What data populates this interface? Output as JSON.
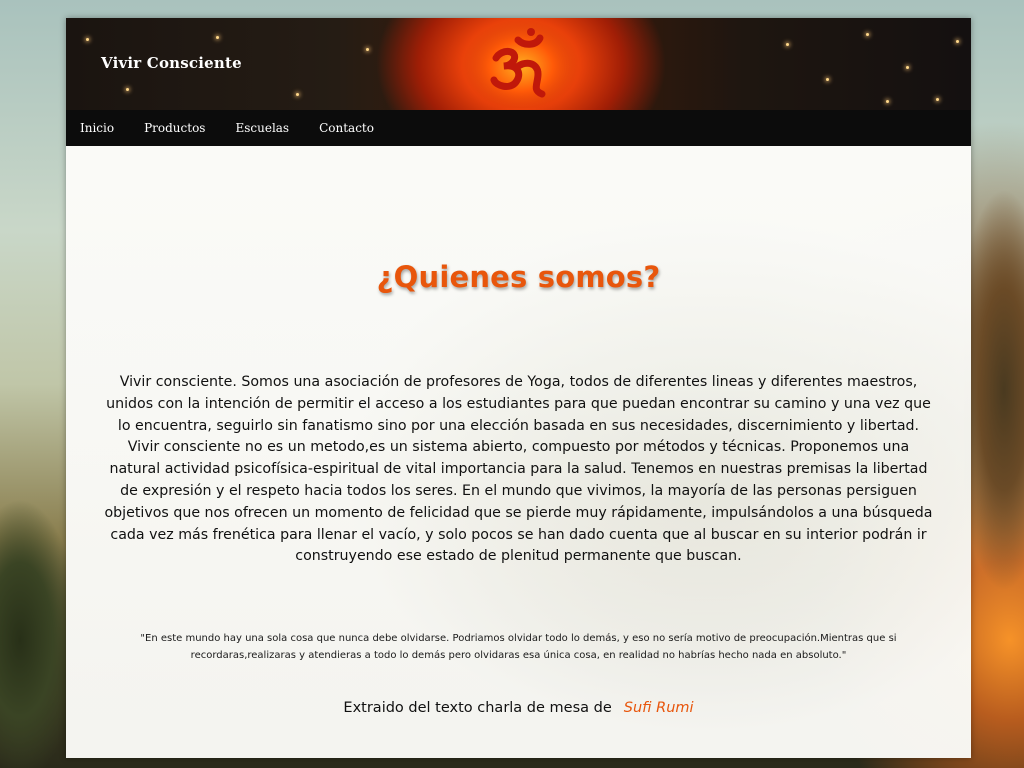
{
  "site": {
    "title": "Vivir Consciente"
  },
  "nav": {
    "items": [
      "Inicio",
      "Productos",
      "Escuelas",
      "Contacto"
    ]
  },
  "page": {
    "heading": "¿Quienes somos?",
    "paragraphs": [
      "Vivir consciente. Somos una asociación de profesores de Yoga, todos de diferentes lineas y diferentes maestros, unidos con la intención de permitir el acceso a los estudiantes para que puedan encontrar su camino y una vez que lo encuentra, seguirlo sin fanatismo sino por una elección basada en sus necesidades, discernimiento y libertad.",
      "Vivir consciente no es un metodo,es un sistema abierto, compuesto por métodos y técnicas. Proponemos una natural actividad psicofísica-espiritual de vital importancia para la salud. Tenemos en nuestras premisas la libertad de expresión y el respeto hacia todos los seres. En el mundo que vivimos, la mayoría de las personas persiguen objetivos que nos ofrecen un momento de felicidad que se pierde muy rápidamente, impulsándolos a una búsqueda cada vez más frenética para llenar el vacío, y solo pocos se han dado cuenta que al buscar en su interior podrán ir construyendo ese estado de plenitud permanente que buscan."
    ],
    "quote": "\"En este mundo hay una sola cosa que nunca debe olvidarse. Podriamos olvidar todo lo demás, y eso no sería motivo de preocupación.Mientras que si recordaras,realizaras y atendieras a todo lo demás pero olvidaras esa única cosa, en realidad no habrías hecho nada en absoluto.\"",
    "attribution_prefix": "Extraido del texto charla de mesa de",
    "attribution_author": "Sufi Rumi"
  },
  "colors": {
    "accent": "#e8560c",
    "navbar": "#0c0c0c",
    "text": "#111111"
  },
  "icons": {
    "logo": "om-symbol-icon"
  }
}
